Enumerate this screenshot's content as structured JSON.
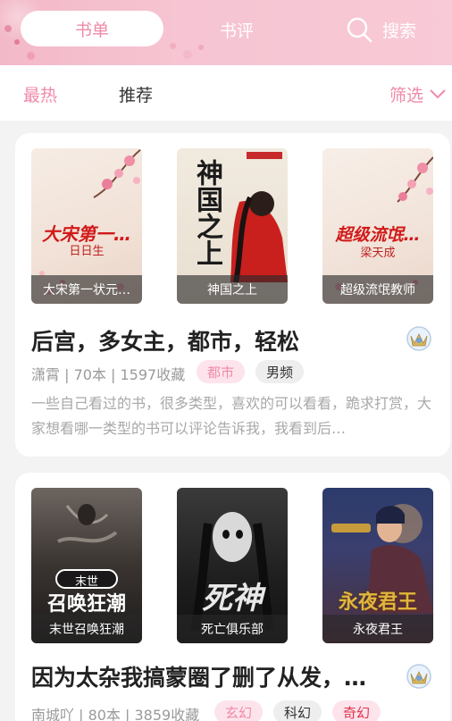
{
  "header": {
    "tab_shelf": "书单",
    "tab_review": "书评",
    "search_label": "搜索"
  },
  "filters": {
    "hot": "最热",
    "recommended": "推荐",
    "filter": "筛选"
  },
  "lists": [
    {
      "title": "后宫，多女主，都市，轻松",
      "meta": "潇霄 | 70本 | 1597收藏",
      "tags": [
        "都市",
        "男频"
      ],
      "description": "一些自己看过的书，很多类型，喜欢的可以看看，跪求打赏，大家想看哪一类型的书可以评论告诉我，我看到后…",
      "books": [
        {
          "caption": "大宋第一状元…",
          "cover_title": "大宋第一…",
          "cover_author": "日日生"
        },
        {
          "caption": "神国之上",
          "cover_title": "神国之上",
          "cover_author": ""
        },
        {
          "caption": "超级流氓教师",
          "cover_title": "超级流氓…",
          "cover_author": "梁天成"
        }
      ]
    },
    {
      "title": "因为太杂我搞蒙圈了删了从发，…",
      "meta": "南城吖 | 80本 | 3859收藏",
      "tags": [
        "玄幻",
        "科幻",
        "奇幻"
      ],
      "books": [
        {
          "caption": "末世召唤狂潮",
          "cover_title": "召唤狂潮",
          "cover_author": "末世"
        },
        {
          "caption": "死亡俱乐部",
          "cover_title": "死神",
          "cover_author": ""
        },
        {
          "caption": "永夜君王",
          "cover_title": "永夜君王",
          "cover_author": ""
        }
      ]
    }
  ],
  "colors": {
    "accent": "#f08aa8",
    "tag_pink_bg": "#fde4ec",
    "tag_gray_bg": "#eeeeee",
    "tag_red_text": "#e0304a"
  }
}
